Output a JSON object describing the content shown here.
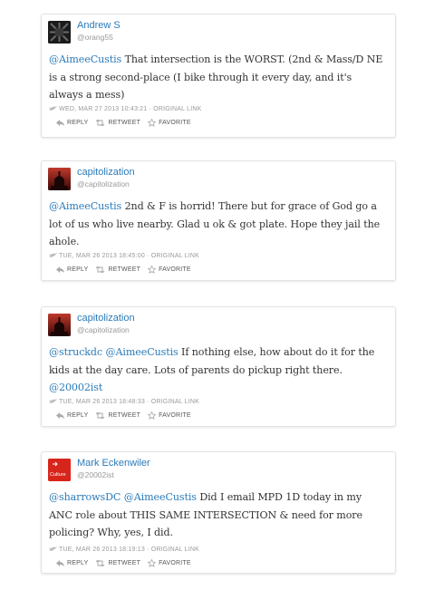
{
  "tweets": [
    {
      "name": "Andrew S",
      "handle": "@orang55",
      "avatar": "avatar-dark-pattern",
      "segments": [
        {
          "t": "@AimeeCustis",
          "m": true
        },
        {
          "t": " That intersection is the WORST. (2nd & Mass/D NE is a strong second-place (I bike through it every day, and it's always a mess)",
          "m": false
        }
      ],
      "timestamp": "WED, MAR 27 2013 10:43:21",
      "link": "ORIGINAL LINK"
    },
    {
      "name": "capitolization",
      "handle": "@capitolization",
      "avatar": "avatar-capitol-red",
      "segments": [
        {
          "t": "@AimeeCustis",
          "m": true
        },
        {
          "t": " 2nd & F is horrid! There but for grace of God go a lot of us who live nearby. Glad u ok & got plate. Hope they jail the ahole.",
          "m": false
        }
      ],
      "timestamp": "TUE, MAR 26 2013 18:45:00",
      "link": "ORIGINAL LINK"
    },
    {
      "name": "capitolization",
      "handle": "@capitolization",
      "avatar": "avatar-capitol-red",
      "segments": [
        {
          "t": "@struckdc",
          "m": true
        },
        {
          "t": " ",
          "m": false
        },
        {
          "t": "@AimeeCustis",
          "m": true
        },
        {
          "t": " If nothing else, how about do it for the kids at the day care. Lots of parents do pickup right there. ",
          "m": false
        },
        {
          "t": "@20002ist",
          "m": true
        }
      ],
      "timestamp": "TUE, MAR 26 2013 18:48:33",
      "link": "ORIGINAL LINK"
    },
    {
      "name": "Mark Eckenwiler",
      "handle": "@20002ist",
      "avatar": "avatar-culture-red",
      "avatar_text": "Culture",
      "segments": [
        {
          "t": "@sharrowsDC",
          "m": true
        },
        {
          "t": " ",
          "m": false
        },
        {
          "t": "@AimeeCustis",
          "m": true
        },
        {
          "t": " Did I email MPD 1D today in my ANC role about THIS SAME INTERSECTION & need for more policing? Why, yes, I did.",
          "m": false
        }
      ],
      "timestamp": "TUE, MAR 26 2013 18:19:13",
      "link": "ORIGINAL LINK"
    }
  ],
  "actions": {
    "reply": "REPLY",
    "retweet": "RETWEET",
    "favorite": "FAVORITE"
  },
  "colors": {
    "link": "#2b7bb9",
    "text": "#333333",
    "meta": "#999999"
  }
}
